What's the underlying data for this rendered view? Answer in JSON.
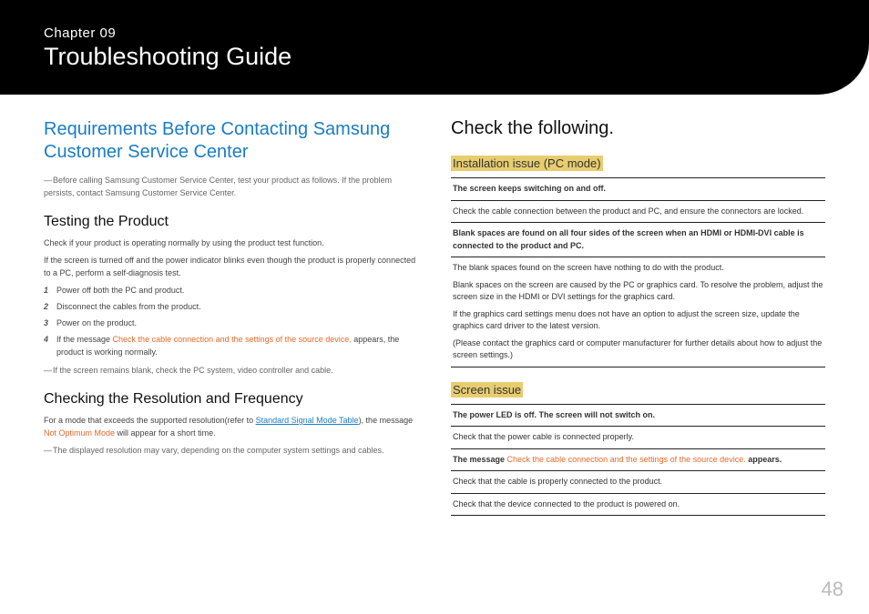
{
  "header": {
    "chapter": "Chapter 09",
    "title": "Troubleshooting Guide"
  },
  "left": {
    "heading": "Requirements Before Contacting Samsung Customer Service Center",
    "note1_dash": "―",
    "note1": "Before calling Samsung Customer Service Center, test your product as follows. If the problem persists, contact Samsung Customer Service Center.",
    "sub1": "Testing the Product",
    "p1": "Check if your product is operating normally by using the product test function.",
    "p2": "If the screen is turned off and the power indicator blinks even though the product is properly connected to a PC, perform a self-diagnosis test.",
    "steps": [
      "Power off both the PC and product.",
      "Disconnect the cables from the product.",
      "Power on the product."
    ],
    "step4_pre": "If the message ",
    "step4_msg": "Check the cable connection and the settings of the source device.",
    "step4_post": " appears, the product is working normally.",
    "note2_dash": "―",
    "note2": "If the screen remains blank, check the PC system, video controller and cable.",
    "sub2": "Checking the Resolution and Frequency",
    "p3_pre": "For a mode that exceeds the supported resolution(refer to ",
    "p3_link": "Standard Signal Mode Table",
    "p3_mid": "), the message ",
    "p3_msg": "Not Optimum Mode",
    "p3_post": " will appear for a short time.",
    "note3_dash": "―",
    "note3": "The displayed resolution may vary, depending on the computer system settings and cables."
  },
  "right": {
    "heading": "Check the following.",
    "group1_label": "Installation issue (PC mode)",
    "t1": [
      {
        "q": "The screen keeps switching on and off.",
        "a": "Check the cable connection between the product and PC, and ensure the connectors are locked."
      },
      {
        "q": "Blank spaces are found on all four sides of the screen when an HDMI or HDMI-DVI cable is connected to the product and PC.",
        "a1": "The blank spaces found on the screen have nothing to do with the product.",
        "a2": "Blank spaces on the screen are caused by the PC or graphics card. To resolve the problem, adjust the screen size in the HDMI or DVI settings for the graphics card.",
        "a3": "If the graphics card settings menu does not have an option to adjust the screen size, update the graphics card driver to the latest version.",
        "a4": "(Please contact the graphics card or computer manufacturer for further details about how to adjust the screen settings.)"
      }
    ],
    "group2_label": "Screen issue",
    "t2": [
      {
        "q": "The power LED is off. The screen will not switch on.",
        "a": "Check that the power cable is connected properly."
      },
      {
        "q_pre": "The message ",
        "q_msg": "Check the cable connection and the settings of the source device.",
        "q_post": " appears.",
        "a1": "Check that the cable is properly connected to the product.",
        "a2": "Check that the device connected to the product is powered on."
      }
    ]
  },
  "page": "48"
}
